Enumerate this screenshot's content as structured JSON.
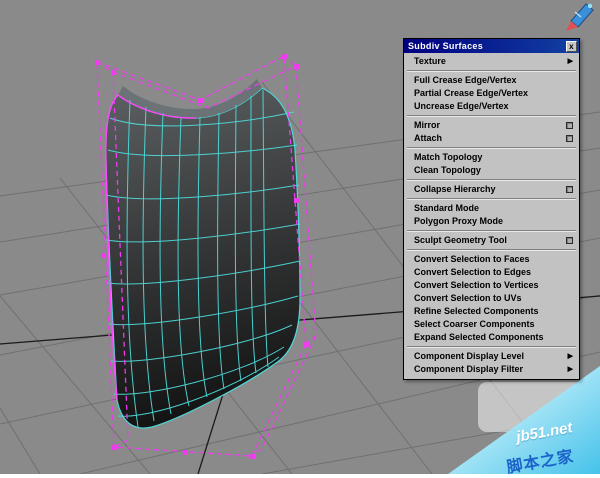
{
  "viewport": {
    "bg_color": "#8a8a8a",
    "grid_color": "#707070",
    "axis_color": "#1a1a1a",
    "wire_color": "#4ed8d8",
    "cage_color": "#ee3cee",
    "selected_color": "#ff47ff",
    "face_top": "#5d6163",
    "face_bottom": "#141414"
  },
  "menu": {
    "title": "Subdiv Surfaces",
    "close_label": "x",
    "items": [
      {
        "label": "Texture",
        "submenu": true
      },
      {
        "type": "separator"
      },
      {
        "label": "Full Crease Edge/Vertex"
      },
      {
        "label": "Partial Crease Edge/Vertex"
      },
      {
        "label": "Uncrease Edge/Vertex"
      },
      {
        "type": "separator"
      },
      {
        "label": "Mirror",
        "optionbox": true
      },
      {
        "label": "Attach",
        "optionbox": true
      },
      {
        "type": "separator"
      },
      {
        "label": "Match Topology"
      },
      {
        "label": "Clean Topology"
      },
      {
        "type": "separator"
      },
      {
        "label": "Collapse Hierarchy",
        "optionbox": true
      },
      {
        "type": "separator"
      },
      {
        "label": "Standard Mode"
      },
      {
        "label": "Polygon Proxy Mode"
      },
      {
        "type": "separator"
      },
      {
        "label": "Sculpt Geometry Tool",
        "optionbox": true
      },
      {
        "type": "separator"
      },
      {
        "label": "Convert Selection to Faces"
      },
      {
        "label": "Convert Selection to Edges"
      },
      {
        "label": "Convert Selection to Vertices"
      },
      {
        "label": "Convert Selection to UVs"
      },
      {
        "label": "Refine Selected Components"
      },
      {
        "label": "Select Coarser Components"
      },
      {
        "label": "Expand Selected Components"
      },
      {
        "type": "separator"
      },
      {
        "label": "Component Display Level",
        "submenu": true
      },
      {
        "label": "Component Display Filter",
        "submenu": true
      }
    ]
  },
  "watermark": {
    "site": "jb51.net",
    "site_name_cn": "脚本之家"
  }
}
